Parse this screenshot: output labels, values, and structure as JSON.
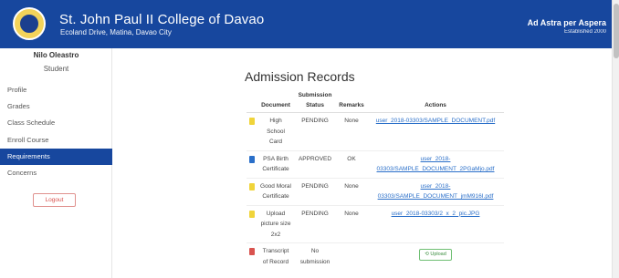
{
  "header": {
    "school_name": "St. John Paul II College of Davao",
    "address": "Ecoland Drive, Matina, Davao City",
    "motto": "Ad Astra per Aspera",
    "established": "Established 2000"
  },
  "sidebar": {
    "user_name": "Nilo Oleastro",
    "user_role": "Student",
    "items": [
      {
        "label": "Profile"
      },
      {
        "label": "Grades"
      },
      {
        "label": "Class Schedule"
      },
      {
        "label": "Enroll Course"
      },
      {
        "label": "Requirements",
        "active": true
      },
      {
        "label": "Concerns"
      }
    ],
    "logout_label": "Logout"
  },
  "main": {
    "title": "Admission Records",
    "columns": {
      "document": "Document",
      "status": "Submission Status",
      "remarks": "Remarks",
      "actions": "Actions"
    },
    "rows": [
      {
        "icon": "file-yellow-icon",
        "icon_color": "#f0d43a",
        "document": "High School Card",
        "status": "PENDING",
        "remarks": "None",
        "action": "user_2018-03303/SAMPLE_DOCUMENT.pdf"
      },
      {
        "icon": "file-blue-icon",
        "icon_color": "#2a6fc9",
        "document": "PSA Birth Certificate",
        "status": "APPROVED",
        "remarks": "OK",
        "action": "user_2018-03303/SAMPLE_DOCUMENT_2PGaMjo.pdf"
      },
      {
        "icon": "file-yellow-icon",
        "icon_color": "#f0d43a",
        "document": "Good Moral Certificate",
        "status": "PENDING",
        "remarks": "None",
        "action": "user_2018-03303/SAMPLE_DOCUMENT_jmM916I.pdf"
      },
      {
        "icon": "file-yellow-icon",
        "icon_color": "#f0d43a",
        "document": "Upload picture size 2x2",
        "status": "PENDING",
        "remarks": "None",
        "action": "user_2018-03303/2_x_2_pic.JPG"
      },
      {
        "icon": "file-red-icon",
        "icon_color": "#d9534f",
        "document": "Transcript of Record",
        "status": "No submission",
        "remarks": "",
        "action": "Upload"
      }
    ]
  },
  "colors": {
    "header": "#17479e",
    "active_nav": "#17479e",
    "link": "#2a6fc9",
    "logout": "#d9534f",
    "upload": "#3c8f40"
  }
}
